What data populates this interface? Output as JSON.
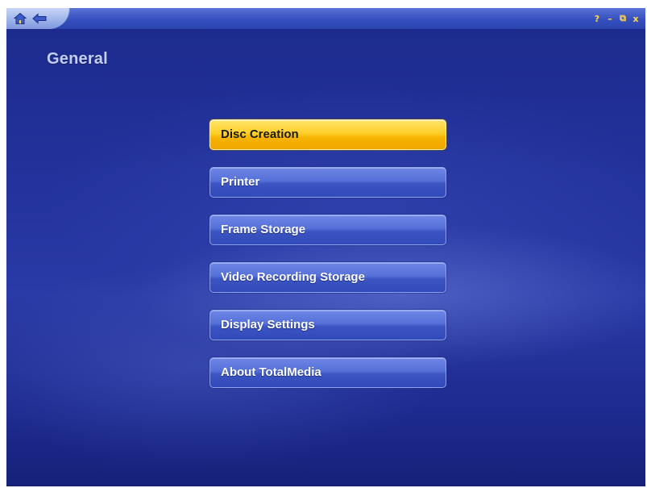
{
  "window": {
    "controls": [
      {
        "name": "help-button",
        "label": "?"
      },
      {
        "name": "minimize-button",
        "label": "–"
      },
      {
        "name": "restore-button",
        "label": "⧉"
      },
      {
        "name": "close-button",
        "label": "x"
      }
    ]
  },
  "page": {
    "title": "General"
  },
  "menu": {
    "items": [
      {
        "label": "Disc Creation",
        "selected": true
      },
      {
        "label": "Printer",
        "selected": false
      },
      {
        "label": "Frame Storage",
        "selected": false
      },
      {
        "label": "Video Recording Storage",
        "selected": false
      },
      {
        "label": "Display Settings",
        "selected": false
      },
      {
        "label": "About TotalMedia",
        "selected": false
      }
    ]
  },
  "icons": {
    "home": "home-icon",
    "back": "back-arrow-icon"
  },
  "colors": {
    "background": "#24339e",
    "selected_button": "#ffd02a",
    "button": "#4a64cf",
    "title_text": "#c4cff6",
    "window_control": "#ffd84a"
  }
}
